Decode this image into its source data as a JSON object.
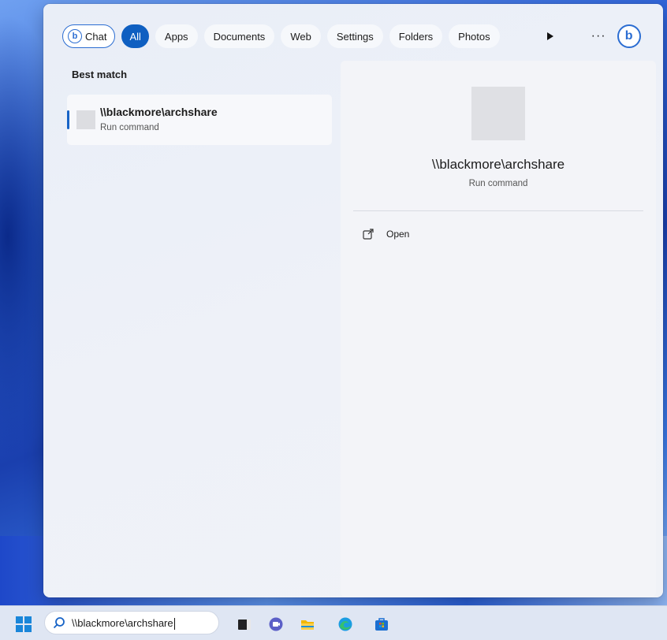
{
  "filters": {
    "chat": "Chat",
    "chat_icon_letter": "b",
    "items": [
      "All",
      "Apps",
      "Documents",
      "Web",
      "Settings",
      "Folders",
      "Photos"
    ],
    "more": "···",
    "bing_letter": "b"
  },
  "best_match": {
    "title": "Best match",
    "result_name": "\\\\blackmore\\archshare",
    "result_type": "Run command"
  },
  "preview": {
    "name": "\\\\blackmore\\archshare",
    "type": "Run command",
    "actions": [
      {
        "label": "Open",
        "icon": "external-link-icon"
      }
    ]
  },
  "taskbar": {
    "search_value": "\\\\blackmore\\archshare",
    "apps": [
      "task-view-icon",
      "teams-chat-icon",
      "file-explorer-icon",
      "edge-icon",
      "store-icon"
    ]
  },
  "colors": {
    "accent": "#0f5fc1",
    "bing": "#2b6dd2"
  }
}
